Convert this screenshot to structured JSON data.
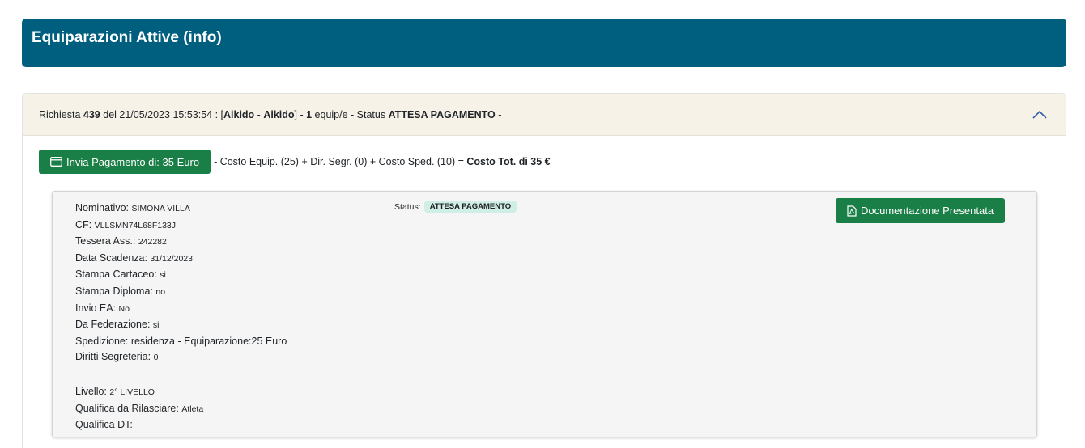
{
  "header": {
    "title": "Equiparazioni Attive (info)"
  },
  "request": {
    "prefix": "Richiesta",
    "number": "439",
    "date_text": "del 21/05/2023 15:53:54 : [",
    "discipline1": "Aikido",
    "sep": " - ",
    "discipline2": "Aikido",
    "after_bracket": "] - ",
    "count": "1",
    "equip_label": " equip/e - Status ",
    "status": "ATTESA PAGAMENTO",
    "tail": " -"
  },
  "payment": {
    "button_label": "Invia Pagamento di: 35 Euro",
    "breakdown": "- Costo Equip. (25) + Dir. Segr. (0) + Costo Sped. (10) = ",
    "total": "Costo Tot. di 35 €"
  },
  "details": {
    "fields": [
      {
        "label": "Nominativo: ",
        "value": "SIMONA VILLA"
      },
      {
        "label": "CF: ",
        "value": "VLLSMN74L68F133J"
      },
      {
        "label": "Tessera Ass.: ",
        "value": "242282"
      },
      {
        "label": "Data Scadenza: ",
        "value": "31/12/2023"
      },
      {
        "label": "Stampa Cartaceo: ",
        "value": "si"
      },
      {
        "label": "Stampa Diploma: ",
        "value": "no"
      },
      {
        "label": "Invio EA: ",
        "value": "No"
      },
      {
        "label": "Da Federazione: ",
        "value": "si"
      },
      {
        "label": "Spedizione: ",
        "value": "residenza - Equiparazione:25 Euro"
      },
      {
        "label": "Diritti Segreteria: ",
        "value": "0"
      }
    ],
    "status_label": "Status:",
    "status_badge": "ATTESA PAGAMENTO",
    "doc_button_label": "Documentazione Presentata",
    "fields2": [
      {
        "label": "Livello: ",
        "value": "2° LIVELLO"
      },
      {
        "label": "Qualifica da Rilasciare: ",
        "value": "Atleta"
      },
      {
        "label": "Qualifica DT: ",
        "value": ""
      }
    ]
  },
  "colors": {
    "header_bg": "#005f7f",
    "button_green": "#1a7f47",
    "card_head_bg": "#f7f2e8",
    "badge_bg": "#cfeee6"
  },
  "icons": {
    "collapse": "chevron-up-icon",
    "payment": "credit-card-icon",
    "document": "file-pdf-icon"
  }
}
